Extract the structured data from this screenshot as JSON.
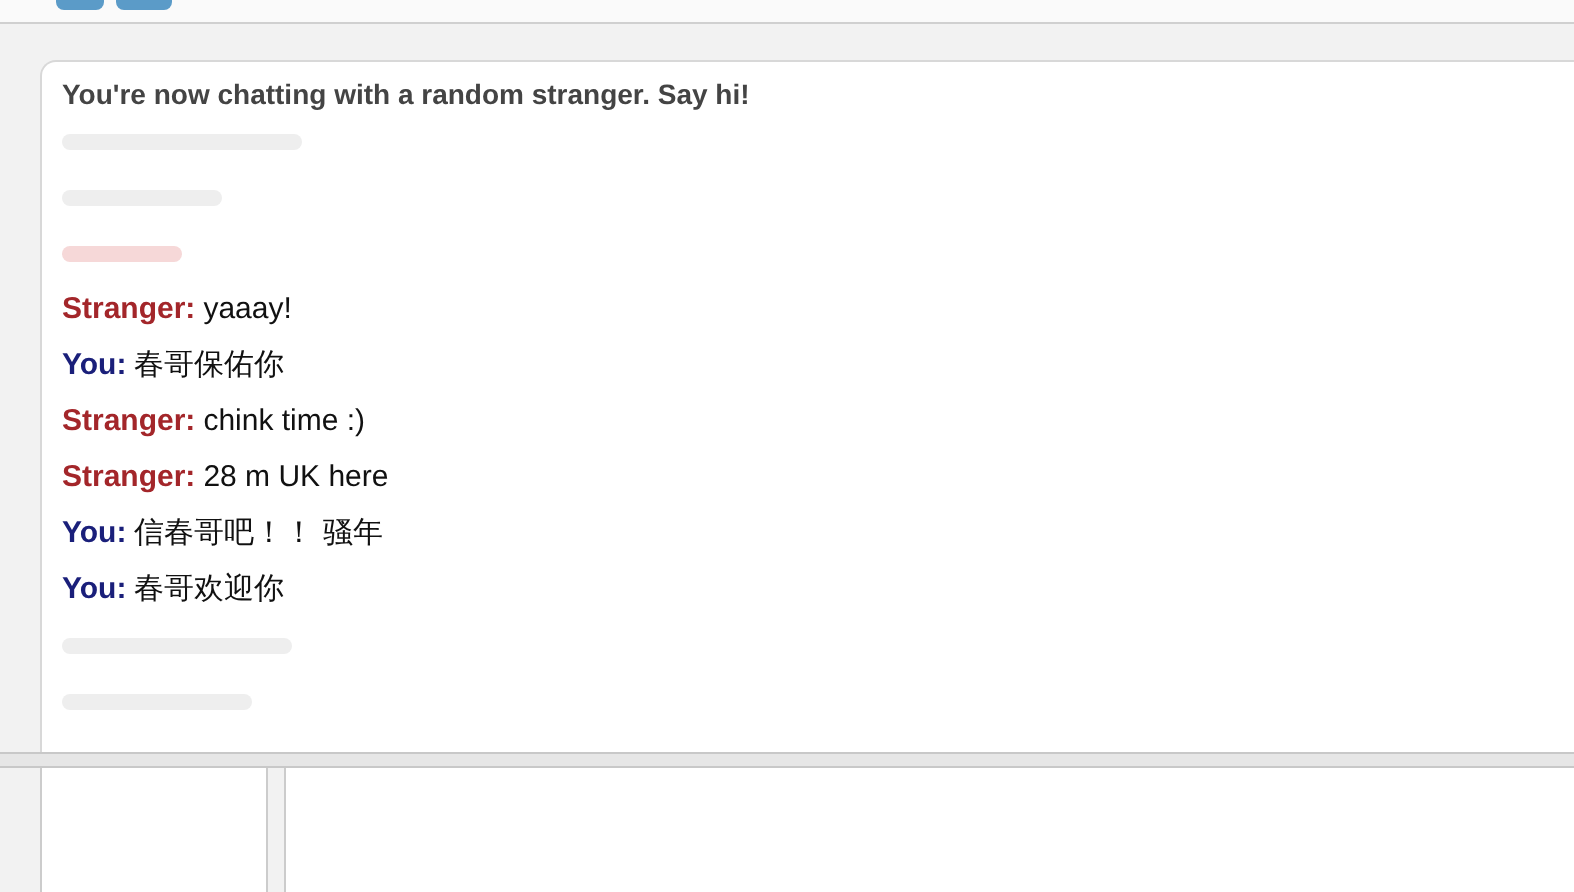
{
  "status": "You're now chatting with a random stranger. Say hi!",
  "messages": [
    {
      "kind": "stranger",
      "speaker": "Stranger:",
      "text": "yaaay!"
    },
    {
      "kind": "you",
      "speaker": "You:",
      "text": "春哥保佑你"
    },
    {
      "kind": "stranger",
      "speaker": "Stranger:",
      "text": "chink time :)"
    },
    {
      "kind": "stranger",
      "speaker": "Stranger:",
      "text": "28 m UK here"
    },
    {
      "kind": "you",
      "speaker": "You:",
      "text": "信春哥吧！！ 骚年"
    },
    {
      "kind": "you",
      "speaker": "You:",
      "text": "春哥欢迎你"
    }
  ]
}
